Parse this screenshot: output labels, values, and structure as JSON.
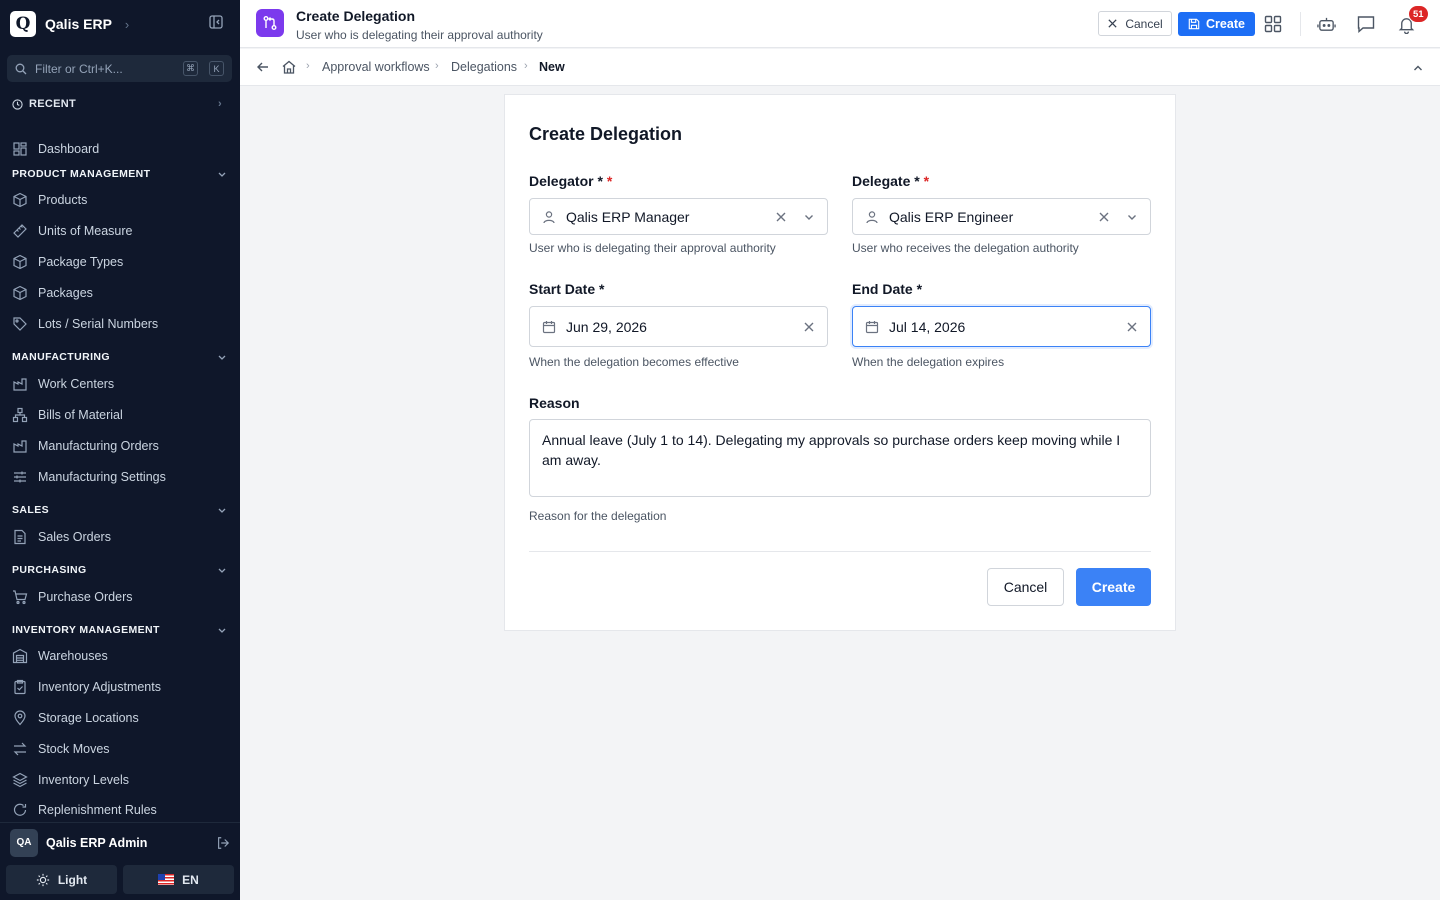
{
  "sidebar": {
    "brand": {
      "logo_letter": "Q",
      "name": "Qalis ERP"
    },
    "filter": {
      "placeholder": "Filter or Ctrl+K...",
      "kbd1": "⌘",
      "kbd2": "K"
    },
    "recent_label": "RECENT",
    "dashboard": "Dashboard",
    "sections": {
      "product": "PRODUCT MANAGEMENT",
      "manufacturing": "MANUFACTURING",
      "sales": "SALES",
      "purchasing": "PURCHASING",
      "inventory": "INVENTORY MANAGEMENT"
    },
    "items": {
      "products": "Products",
      "uom": "Units of Measure",
      "package_types": "Package Types",
      "packages": "Packages",
      "lots": "Lots / Serial Numbers",
      "work_centers": "Work Centers",
      "bom": "Bills of Material",
      "mfg_orders": "Manufacturing Orders",
      "mfg_settings": "Manufacturing Settings",
      "sales_orders": "Sales Orders",
      "purchase_orders": "Purchase Orders",
      "warehouses": "Warehouses",
      "inv_adjustments": "Inventory Adjustments",
      "storage_locations": "Storage Locations",
      "stock_moves": "Stock Moves",
      "inventory_levels": "Inventory Levels",
      "replenishment": "Replenishment Rules"
    },
    "user": {
      "initials": "QA",
      "name": "Qalis ERP Admin"
    },
    "theme_label": "Light",
    "lang_label": "EN"
  },
  "header": {
    "title": "Create Delegation",
    "subtitle": "User who is delegating their approval authority",
    "cancel_label": "Cancel",
    "create_label": "Create",
    "notification_count": "51"
  },
  "breadcrumb": {
    "items": [
      "Approval workflows",
      "Delegations"
    ],
    "current": "New"
  },
  "form": {
    "title": "Create Delegation",
    "delegator": {
      "label": "Delegator *",
      "value": "Qalis ERP Manager",
      "help": "User who is delegating their approval authority"
    },
    "delegate": {
      "label": "Delegate *",
      "value": "Qalis ERP Engineer",
      "help": "User who receives the delegation authority"
    },
    "start_date": {
      "label": "Start Date *",
      "value": "Jun 29, 2026",
      "help": "When the delegation becomes effective"
    },
    "end_date": {
      "label": "End Date *",
      "value": "Jul 14, 2026",
      "help": "When the delegation expires"
    },
    "reason": {
      "label": "Reason",
      "value": "Annual leave (July 1 to 14). Delegating my approvals so purchase orders keep moving while I am away.",
      "help": "Reason for the delegation"
    },
    "cancel_label": "Cancel",
    "create_label": "Create"
  },
  "colors": {
    "accent": "#3b82f6",
    "sidebar_bg": "#0f172a",
    "page_icon": "#7c3aed",
    "badge": "#dc2626"
  }
}
